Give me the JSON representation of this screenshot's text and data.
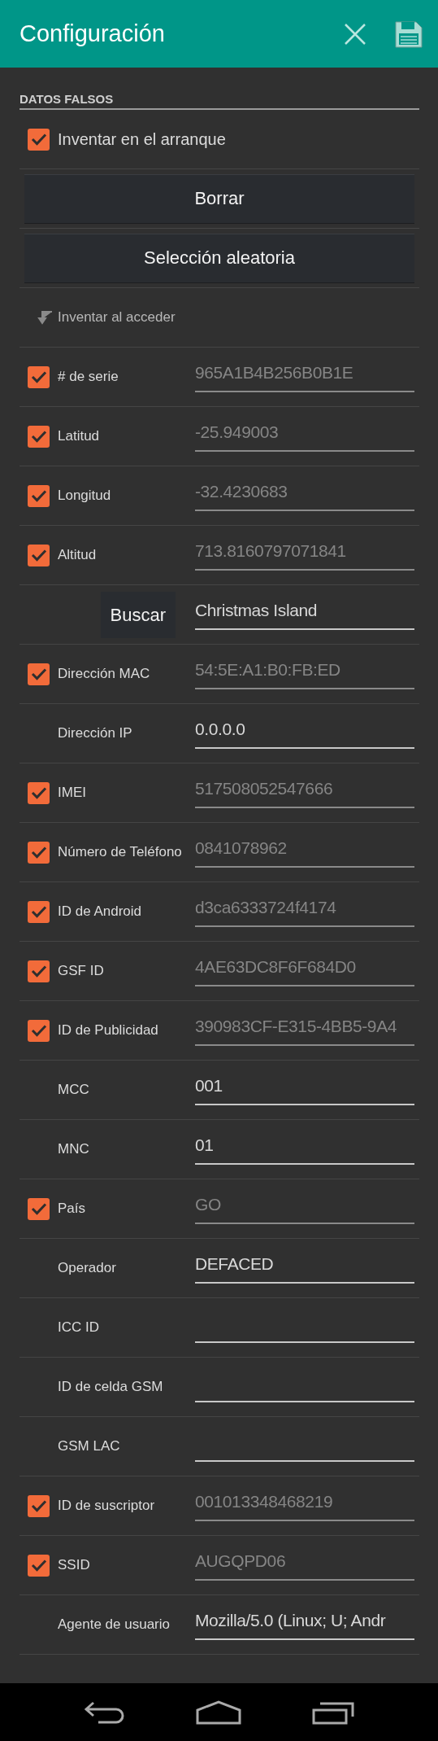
{
  "app_bar": {
    "title": "Configuración"
  },
  "section": {
    "title": "DATOS FALSOS"
  },
  "startup": {
    "label": "Inventar en el arranque",
    "checked": true
  },
  "buttons": [
    "Borrar",
    "Selección aleatoria"
  ],
  "note": {
    "label": "Inventar al acceder"
  },
  "rows": [
    {
      "kind": "check",
      "label": "# de serie",
      "checked": true,
      "value": "965A1B4B256B0B1E"
    },
    {
      "kind": "check",
      "label": "Latitud",
      "checked": true,
      "value": "-25.949003"
    },
    {
      "kind": "check",
      "label": "Longitud",
      "checked": true,
      "value": "-32.4230683"
    },
    {
      "kind": "check",
      "label": "Altitud",
      "checked": true,
      "value": "713.8160797071841"
    },
    {
      "kind": "search",
      "button": "Buscar",
      "value": "Christmas Island"
    },
    {
      "kind": "check",
      "label": "Dirección MAC",
      "checked": true,
      "value": "54:5E:A1:B0:FB:ED"
    },
    {
      "kind": "field",
      "label": "Dirección IP",
      "value": "0.0.0.0"
    },
    {
      "kind": "check",
      "label": "IMEI",
      "checked": true,
      "value": "517508052547666"
    },
    {
      "kind": "check",
      "label": "Número de Teléfono",
      "checked": true,
      "value": "0841078962"
    },
    {
      "kind": "check",
      "label": "ID de Android",
      "checked": true,
      "value": "d3ca6333724f4174"
    },
    {
      "kind": "check",
      "label": "GSF ID",
      "checked": true,
      "value": "4AE63DC8F6F684D0"
    },
    {
      "kind": "check",
      "label": "ID de Publicidad",
      "checked": true,
      "value": "390983CF-E315-4BB5-9A4"
    },
    {
      "kind": "field",
      "label": "MCC",
      "value": "001"
    },
    {
      "kind": "field",
      "label": "MNC",
      "value": "01"
    },
    {
      "kind": "check",
      "label": "País",
      "checked": true,
      "value": "GO"
    },
    {
      "kind": "field",
      "label": "Operador",
      "value": "DEFACED"
    },
    {
      "kind": "field",
      "label": "ICC ID"
    },
    {
      "kind": "field",
      "label": "ID de celda GSM"
    },
    {
      "kind": "field",
      "label": "GSM LAC"
    },
    {
      "kind": "check",
      "label": "ID de suscriptor",
      "checked": true,
      "value": "001013348468219"
    },
    {
      "kind": "check",
      "label": "SSID",
      "checked": true,
      "value": "AUGQPD06"
    },
    {
      "kind": "field",
      "label": "Agente de usuario",
      "value": "Mozilla/5.0 (Linux; U; Andr"
    }
  ]
}
